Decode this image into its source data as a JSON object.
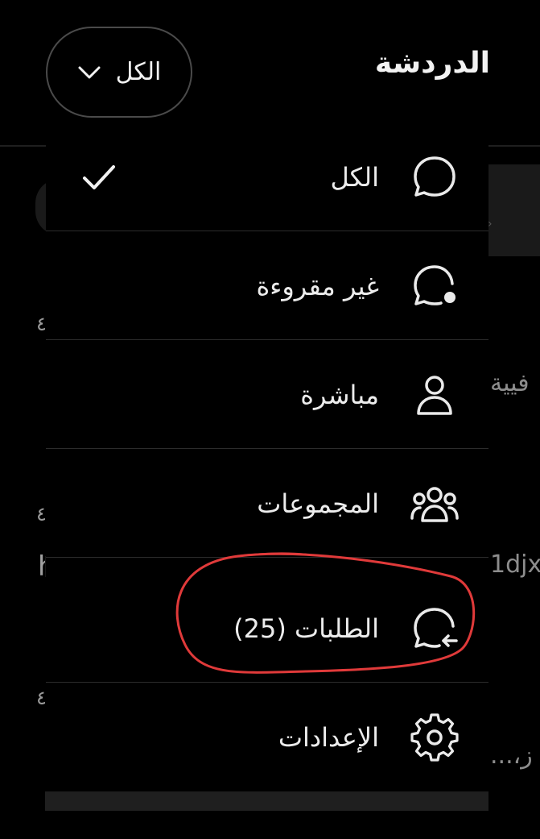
{
  "header": {
    "title": "الدردشة",
    "filter_label": "الكل"
  },
  "menu": {
    "items": [
      {
        "label": "الكل",
        "icon": "chat-bubble-icon",
        "selected": true
      },
      {
        "label": "غير مقروءة",
        "icon": "chat-bubble-unread-icon",
        "selected": false
      },
      {
        "label": "مباشرة",
        "icon": "person-icon",
        "selected": false
      },
      {
        "label": "المجموعات",
        "icon": "group-icon",
        "selected": false
      },
      {
        "label": "الطلبات (25)",
        "icon": "chat-bubble-request-icon",
        "selected": false
      },
      {
        "label": "الإعدادات",
        "icon": "gear-icon",
        "selected": false
      }
    ]
  },
  "background": {
    "time_1": "٤",
    "time_2": "٤",
    "time_3": "٤",
    "snippet_1": "فيية",
    "snippet_2": "1djx",
    "snippet_3": "ز،...",
    "snippet_left": "h"
  },
  "colors": {
    "background": "#000000",
    "text": "#ececec",
    "divider": "#2c2c2c",
    "annotation": "#e03a3a"
  }
}
